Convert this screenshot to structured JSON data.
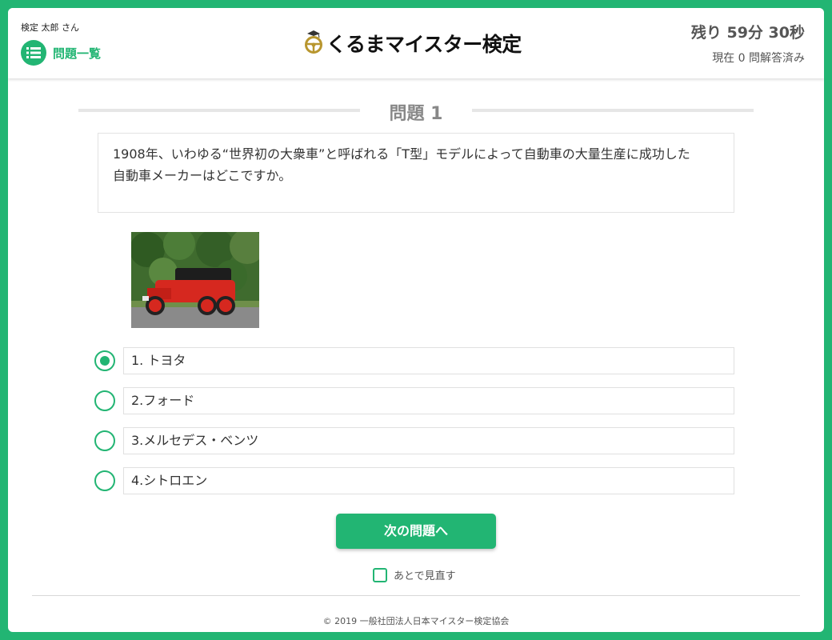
{
  "header": {
    "user_name": "検定 太郎 さん",
    "list_label": "問題一覧",
    "logo_text": "くるまマイスター検定",
    "timer": "残り 59分 30秒",
    "answered": "現在 0 問解答済み"
  },
  "question": {
    "title": "問題 1",
    "text_line1": "1908年、いわゆる“世界初の大衆車”と呼ばれる「T型」モデルによって自動車の大量生産に成功した",
    "text_line2": "自動車メーカーはどこですか。"
  },
  "options": [
    {
      "label": "1. トヨタ",
      "selected": true
    },
    {
      "label": "2.フォード",
      "selected": false
    },
    {
      "label": "3.メルセデス・ベンツ",
      "selected": false
    },
    {
      "label": "4.シトロエン",
      "selected": false
    }
  ],
  "next_button": "次の問題へ",
  "review_later": "あとで見直す",
  "footer": "© 2019 一般社団法人日本マイスター検定協会",
  "colors": {
    "accent": "#22b573",
    "title_gray": "#888888"
  },
  "icons": {
    "list": "list-icon",
    "logo": "steering-wheel-icon"
  }
}
